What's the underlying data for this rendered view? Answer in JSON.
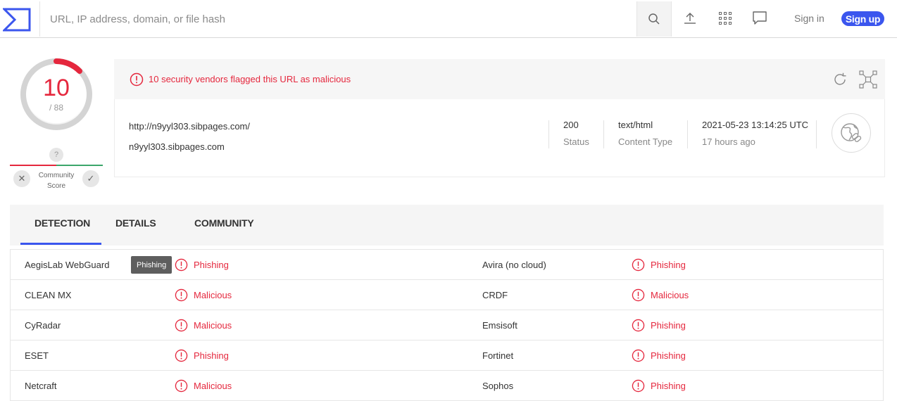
{
  "search": {
    "placeholder": "URL, IP address, domain, or file hash"
  },
  "header": {
    "signin_label": "Sign in",
    "signup_label": "Sign up",
    "icons": [
      "search-icon",
      "upload-icon",
      "apps-grid-icon",
      "chat-icon"
    ]
  },
  "score": {
    "detections": "10",
    "total": "/ 88",
    "community_q": "?",
    "community_label_1": "Community",
    "community_label_2": "Score",
    "downvote": "✕",
    "upvote": "✓"
  },
  "alert": {
    "text": "10 security vendors flagged this URL as malicious"
  },
  "info": {
    "url": "http://n9yyl303.sibpages.com/",
    "domain": "n9yyl303.sibpages.com",
    "status_value": "200",
    "status_label": "Status",
    "content_type_value": "text/html",
    "content_type_label": "Content Type",
    "date_value": "2021-05-23 13:14:25 UTC",
    "date_relative": "17 hours ago"
  },
  "tabs": [
    {
      "label": "DETECTION",
      "active": true
    },
    {
      "label": "DETAILS",
      "active": false
    },
    {
      "label": "COMMUNITY",
      "active": false
    }
  ],
  "tooltip": "Phishing",
  "rows": [
    {
      "left_vendor": "AegisLab WebGuard",
      "left_result": "Phishing",
      "right_vendor": "Avira (no cloud)",
      "right_result": "Phishing"
    },
    {
      "left_vendor": "CLEAN MX",
      "left_result": "Malicious",
      "right_vendor": "CRDF",
      "right_result": "Malicious"
    },
    {
      "left_vendor": "CyRadar",
      "left_result": "Malicious",
      "right_vendor": "Emsisoft",
      "right_result": "Phishing"
    },
    {
      "left_vendor": "ESET",
      "left_result": "Phishing",
      "right_vendor": "Fortinet",
      "right_result": "Phishing"
    },
    {
      "left_vendor": "Netcraft",
      "left_result": "Malicious",
      "right_vendor": "Sophos",
      "right_result": "Phishing"
    }
  ],
  "colors": {
    "accent": "#3b56ee",
    "malicious": "#e5273d",
    "harmless": "#3ca66b"
  }
}
